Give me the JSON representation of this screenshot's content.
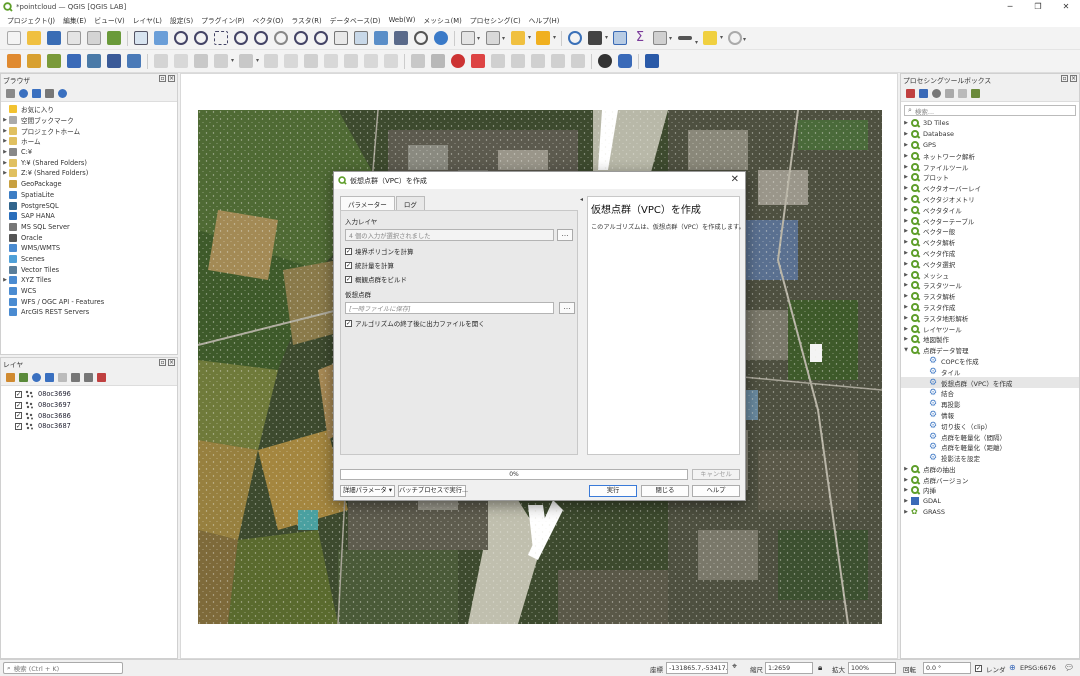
{
  "window": {
    "title": "*pointcloud — QGIS [QGIS LAB]",
    "controls": [
      "─",
      "❐",
      "✕"
    ]
  },
  "menu": [
    "プロジェクト(J)",
    "編集(E)",
    "ビュー(V)",
    "レイヤ(L)",
    "設定(S)",
    "プラグイン(P)",
    "ベクタ(O)",
    "ラスタ(R)",
    "データベース(D)",
    "Web(W)",
    "メッシュ(M)",
    "プロセシング(C)",
    "ヘルプ(H)"
  ],
  "browser": {
    "title": "ブラウザ",
    "items": [
      {
        "label": "お気に入り",
        "arrow": "",
        "color": "#f2c230"
      },
      {
        "label": "空間ブックマーク",
        "arrow": "▶",
        "color": "#aaaaaa"
      },
      {
        "label": "プロジェクトホーム",
        "arrow": "▶",
        "color": "#e0c060"
      },
      {
        "label": "ホーム",
        "arrow": "▶",
        "color": "#e0c060"
      },
      {
        "label": "C:¥",
        "arrow": "▶",
        "color": "#888888"
      },
      {
        "label": "Y:¥ (Shared Folders)",
        "arrow": "▶",
        "color": "#e0c060"
      },
      {
        "label": "Z:¥ (Shared Folders)",
        "arrow": "▶",
        "color": "#e0c060"
      },
      {
        "label": "GeoPackage",
        "arrow": "",
        "color": "#c8a040"
      },
      {
        "label": "SpatiaLite",
        "arrow": "",
        "color": "#3c7dc4"
      },
      {
        "label": "PostgreSQL",
        "arrow": "",
        "color": "#31648c"
      },
      {
        "label": "SAP HANA",
        "arrow": "",
        "color": "#2a6ebb"
      },
      {
        "label": "MS SQL Server",
        "arrow": "",
        "color": "#777777"
      },
      {
        "label": "Oracle",
        "arrow": "",
        "color": "#555555"
      },
      {
        "label": "WMS/WMTS",
        "arrow": "",
        "color": "#4a8bd1"
      },
      {
        "label": "Scenes",
        "arrow": "",
        "color": "#4fa0d8"
      },
      {
        "label": "Vector Tiles",
        "arrow": "",
        "color": "#5a7e9a"
      },
      {
        "label": "XYZ Tiles",
        "arrow": "▶",
        "color": "#4a8bd1"
      },
      {
        "label": "WCS",
        "arrow": "",
        "color": "#4a8bd1"
      },
      {
        "label": "WFS / OGC API - Features",
        "arrow": "",
        "color": "#4a8bd1"
      },
      {
        "label": "ArcGIS REST Servers",
        "arrow": "",
        "color": "#4a8bd1"
      }
    ]
  },
  "layers": {
    "title": "レイヤ",
    "items": [
      "08oc3696",
      "08oc3697",
      "08oc3686",
      "08oc3687"
    ]
  },
  "toolbox": {
    "title": "プロセシングツールボックス",
    "search_placeholder": "検索...",
    "groups": [
      "3D Tiles",
      "Database",
      "GPS",
      "ネットワーク解析",
      "ファイルツール",
      "プロット",
      "ベクタオーバーレイ",
      "ベクタジオメトリ",
      "ベクタタイル",
      "ベクターテーブル",
      "ベクター般",
      "ベクタ解析",
      "ベクタ作成",
      "ベクタ選択",
      "メッシュ",
      "ラスタツール",
      "ラスタ解析",
      "ラスタ作成",
      "ラスタ地形解析",
      "レイヤツール",
      "地図製作"
    ],
    "expanded_group": "点群データ管理",
    "subitems": [
      "COPCを作成",
      "タイル",
      "仮想点群（VPC）を作成",
      "結合",
      "再投影",
      "情報",
      "切り抜く（clip）",
      "点群を軽量化（間隔）",
      "点群を軽量化（距離）",
      "投影法を設定"
    ],
    "selected_subitem": "仮想点群（VPC）を作成",
    "after_groups": [
      "点群の抽出",
      "点群バージョン",
      "内挿"
    ],
    "gdal": "GDAL",
    "grass": "GRASS"
  },
  "dialog": {
    "title": "仮想点群（VPC）を作成",
    "tabs": [
      "パラメーター",
      "ログ"
    ],
    "input_label": "入力レイヤ",
    "input_value": "4 個の入力が選択されました",
    "checks": [
      "境界ポリゴンを計算",
      "統計量を計算",
      "概観点群をビルド"
    ],
    "output_label": "仮想点群",
    "output_placeholder": "[一時ファイルに保存]",
    "open_check": "アルゴリズムの終了後に出力ファイルを開く",
    "help_title": "仮想点群（VPC）を作成",
    "help_text": "このアルゴリズムは、仮想点群（VPC）を作成します。",
    "progress": "0%",
    "progress_value": 0,
    "cancel": "キャンセル",
    "advanced": "詳細パラメータ ▾",
    "batch": "バッチプロセスで実行...",
    "run": "実行",
    "close": "閉じる",
    "help": "ヘルプ",
    "ellipsis": "…"
  },
  "status": {
    "locator_placeholder": "検索 (Ctrl + K)",
    "coord_label": "座標",
    "coord_value": "-131865.7,-53417.4",
    "scale_label": "縮尺",
    "scale_value": "1:2659",
    "magnifier_label": "拡大",
    "magnifier_value": "100%",
    "rotation_label": "回転",
    "rotation_value": "0.0 °",
    "render_label": "レンダ",
    "crs": "EPSG:6676"
  }
}
